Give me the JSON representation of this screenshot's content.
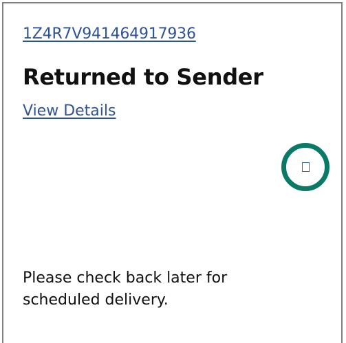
{
  "shipment": {
    "tracking_number": "1Z4R7V941464917936",
    "status": "Returned to Sender",
    "details_link": "View Details",
    "message_line1": "Please check back later for",
    "message_line2": "scheduled delivery."
  },
  "icons": {
    "status_indicator": "status-ring-icon",
    "glyph": "missing-glyph-box-icon"
  },
  "colors": {
    "link": "#2f5496",
    "ring": "#0a7a66",
    "border": "#808080",
    "text": "#111111"
  }
}
